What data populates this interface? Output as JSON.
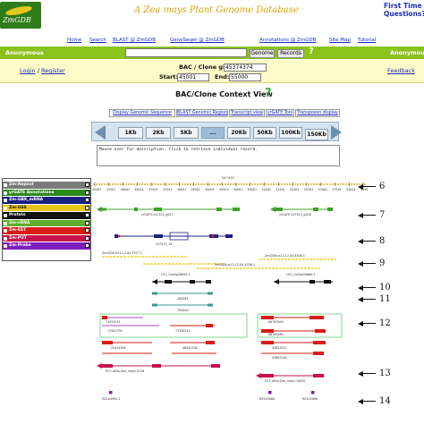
{
  "header": {
    "logo_text": "ZmGDB",
    "site_title": "A Zea mays Plant Genome Database",
    "right_text_1": "First Time",
    "right_text_2": "Questions?"
  },
  "topnav": [
    "Home",
    "Search",
    "BLAST @ ZmGDB",
    "GeneSeqer @ ZmGDB",
    "Annotations @ ZmGDB",
    "Site Map",
    "Tutorial"
  ],
  "search": {
    "user_left": "Anonymous",
    "user_right": "Anonymous",
    "value": "",
    "genome_button": "Genome",
    "records_button": "Records"
  },
  "account": {
    "login": "Login",
    "register": "Register",
    "feedback": "Feedback"
  },
  "bac": {
    "clone_label": "BAC / Clone gi-",
    "clone_value": "45374374",
    "start_label": "Start:",
    "start_value": "45001",
    "end_label": "End:",
    "end_value": "55000"
  },
  "context": {
    "title": "BAC/Clone Context View",
    "links": [
      "Display Genomic Sequence",
      "BLAST Genomic Region",
      "Transcript view",
      "yrGATE Tool",
      "Transposon display"
    ],
    "zoom": [
      "1Kb",
      "2Kb",
      "5Kb",
      "...",
      "20Kb",
      "50Kb",
      "100Kb",
      "150Kb"
    ],
    "zoom_selected": "...",
    "message": "Mouse over for description. Click to retrieve individual record."
  },
  "legend": [
    {
      "label": "Zm-Repeat",
      "color": "#7a7a7a"
    },
    {
      "label": "yrGATE Annotations",
      "color": "#2a8a1a"
    },
    {
      "label": "Zm-GBK_mRNA",
      "color": "#1b2180"
    },
    {
      "label": "Zm-GSS",
      "color": "#e9c612"
    },
    {
      "label": "Protein",
      "color": "#111111"
    },
    {
      "label": "Zm-cDNA",
      "color": "#5fae2a"
    },
    {
      "label": "Zm-EST",
      "color": "#d91c16"
    },
    {
      "label": "Zm-PUT",
      "color": "#c8104a"
    },
    {
      "label": "Zm-Probe",
      "color": "#7f1ec0"
    }
  ],
  "tracks": {
    "ruler_label": "247415",
    "ruler_ticks": [
      "45001",
      "45501",
      "46001",
      "46501",
      "47001",
      "47501",
      "48001",
      "48501",
      "49001",
      "49501",
      "50001",
      "50501",
      "51001",
      "51501",
      "52001",
      "52501",
      "53001",
      "53501",
      "54001",
      "54501"
    ],
    "yrgate_labels": [
      "yrGATE-247415_g017",
      "yrGATE-247415_g018"
    ],
    "mrna_label": "247415_18",
    "gss_labels": [
      "ZmGSStuc11-12-04.7977.1",
      "ZmGSStuc11-12-04.4356.1",
      "ZmGSStuc11-12-04.8308.1"
    ],
    "protein_labels": [
      "LOC_Os04g39650.1",
      "LOC_Os04g39660.1"
    ],
    "cdna_labels": [
      "262061",
      "292009"
    ],
    "est_labels": [
      "71974211",
      "71343795",
      "71358212",
      "66763944",
      "66765084",
      "25444845",
      "46542100",
      "45853011",
      "45883100"
    ],
    "put_labels": [
      "PUT-163a-Zea_mays-9716",
      "PUT-163a-Zea_mays-10030"
    ],
    "probe_labels": [
      "RZ444992.1",
      "RZ443060",
      "RZ443088"
    ]
  },
  "markers": [
    "6",
    "7",
    "8",
    "9",
    "10",
    "11",
    "12",
    "13",
    "14"
  ]
}
